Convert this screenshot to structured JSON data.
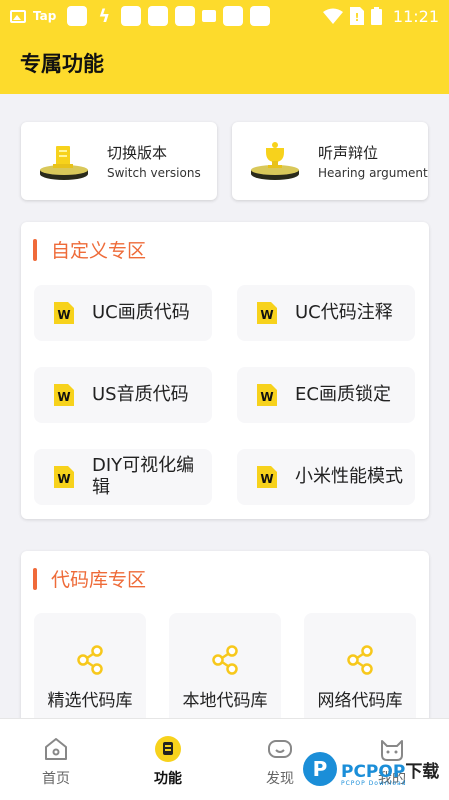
{
  "status_bar": {
    "carrier_label": "Tap",
    "time": "11:21"
  },
  "header": {
    "title": "专属功能"
  },
  "top_cards": [
    {
      "title": "切换版本",
      "subtitle": "Switch versions",
      "icon": "trophy-podium-icon"
    },
    {
      "title": "听声辩位",
      "subtitle": "Hearing argument",
      "icon": "trophy-podium-icon"
    }
  ],
  "custom_section": {
    "title": "自定义专区",
    "items": [
      {
        "label": "UC画质代码",
        "icon": "w-badge-icon"
      },
      {
        "label": "UC代码注释",
        "icon": "w-badge-icon"
      },
      {
        "label": "US音质代码",
        "icon": "w-badge-icon"
      },
      {
        "label": "EC画质锁定",
        "icon": "w-badge-icon"
      },
      {
        "label": "DIY可视化编辑",
        "icon": "w-badge-icon"
      },
      {
        "label": "小米性能模式",
        "icon": "w-badge-icon"
      }
    ]
  },
  "code_section": {
    "title": "代码库专区",
    "items": [
      {
        "label": "精选代码库",
        "icon": "share-icon"
      },
      {
        "label": "本地代码库",
        "icon": "share-icon"
      },
      {
        "label": "网络代码库",
        "icon": "share-icon"
      }
    ]
  },
  "tabbar": {
    "active": "功能",
    "tabs": [
      {
        "label": "首页",
        "icon": "home-icon"
      },
      {
        "label": "功能",
        "icon": "feature-icon"
      },
      {
        "label": "发现",
        "icon": "discover-icon"
      },
      {
        "label": "我的",
        "icon": "cat-profile-icon"
      }
    ]
  },
  "watermark": {
    "logo_letter": "P",
    "brand": "PCPOP",
    "brand_cn": "下载",
    "tagline": "PCPOP Download"
  },
  "colors": {
    "header_yellow": "#fddb2c",
    "section_orange": "#ee6b39",
    "icon_yellow": "#f7d21c",
    "watermark_blue": "#1b8ed8"
  }
}
